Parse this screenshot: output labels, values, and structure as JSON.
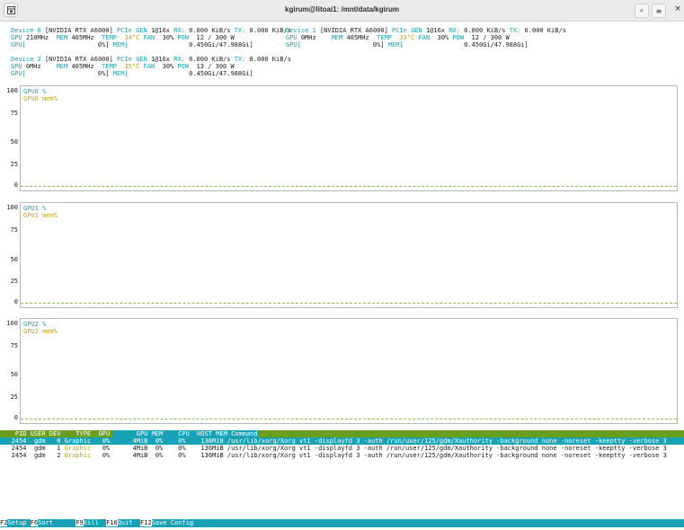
{
  "window": {
    "title": "kgirum@litoai1: /mnt/data/kgirum",
    "icons": {
      "new_tab": "terminal-newtab-icon",
      "search": "search-icon",
      "menu": "hamburger-menu-icon",
      "close": "close-icon"
    },
    "search_glyph": "⌕",
    "menu_glyph": "≡",
    "close_glyph": "×"
  },
  "devices": {
    "dev0": {
      "line1_a": "Device 0 ",
      "line1_b": "[NVIDIA RTX A6000] ",
      "line1_c": "PCIe GEN ",
      "line1_d": "1@16x ",
      "line1_e": "RX: ",
      "line1_f": "0.000 KiB/s ",
      "line1_g": "TX: ",
      "line1_h": "0.000 KiB/s ",
      "line2_a": "GPU ",
      "line2_b": "210MHz  ",
      "line2_c": "MEM ",
      "line2_d": "405MHz  ",
      "line2_e": "TEMP  ",
      "line2_f": "34°C ",
      "line2_g": "FAN  ",
      "line2_h": "30% ",
      "line2_i": "POW  ",
      "line2_j": "12 / 300 W",
      "line3_a": "GPU[",
      "line3_b": "                   0%] ",
      "line3_c": "MEM[",
      "line3_d": "                0.450Gi/47.988Gi]"
    },
    "dev1": {
      "line1_a": "Device 1 ",
      "line1_b": "[NVIDIA RTX A6000] ",
      "line1_c": "PCIe GEN ",
      "line1_d": "1@16x ",
      "line1_e": "RX: ",
      "line1_f": "0.000 KiB/s ",
      "line1_g": "TX: ",
      "line1_h": "0.000 KiB/s",
      "line2_a": "GPU ",
      "line2_b": "0MHz    ",
      "line2_c": "MEM ",
      "line2_d": "405MHz  ",
      "line2_e": "TEMP  ",
      "line2_f": "33°C ",
      "line2_g": "FAN  ",
      "line2_h": "30% ",
      "line2_i": "POW  ",
      "line2_j": "12 / 300 W",
      "line3_a": "GPU[",
      "line3_b": "                   0%] ",
      "line3_c": "MEM[",
      "line3_d": "                0.450Gi/47.988Gi]"
    },
    "dev2": {
      "line1_a": "Device 2 ",
      "line1_b": "[NVIDIA RTX A6000] ",
      "line1_c": "PCIe GEN ",
      "line1_d": "1@16x ",
      "line1_e": "RX: ",
      "line1_f": "0.000 KiB/s ",
      "line1_g": "TX: ",
      "line1_h": "0.000 KiB/s",
      "line2_a": "GPU ",
      "line2_b": "0MHz    ",
      "line2_c": "MEM ",
      "line2_d": "405MHz  ",
      "line2_e": "TEMP  ",
      "line2_f": "35°C ",
      "line2_g": "FAN  ",
      "line2_h": "30% ",
      "line2_i": "POW  ",
      "line2_j": "13 / 300 W",
      "line3_a": "GPU[",
      "line3_b": "                   0%] ",
      "line3_c": "MEM[",
      "line3_d": "                0.450Gi/47.988Gi]"
    }
  },
  "charts": {
    "ytick_labels": {
      "t100": "100",
      "t75": "75",
      "t50": "50",
      "t25": "25",
      "t0": "0"
    },
    "gpu0": {
      "util_label": "GPU0 %",
      "mem_label": "GPU0 mem%"
    },
    "gpu1": {
      "util_label": "GPU1 %",
      "mem_label": "GPU1 mem%"
    },
    "gpu2": {
      "util_label": "GPU2 %",
      "mem_label": "GPU2 mem%"
    }
  },
  "process_table": {
    "header_left": "    PID USER DEV    TYPE  GPU ",
    "header_right": "      GPU MEM    CPU  HOST MEM Command",
    "rows": [
      {
        "pid": "   2454",
        "user": "  gdm",
        "dev": "   0",
        "type": " Graphic",
        "gpu": "   0%",
        "gpu_mem": "      4MiB",
        "mem_pct": "  0%",
        "cpu": "    0%",
        "host_mem": "    136MiB",
        "command": " /usr/lib/xorg/Xorg vt1 -displayfd 3 -auth /run/user/125/gdm/Xauthority -background none -noreset -keeptty -verbose 3"
      },
      {
        "pid": "   2454",
        "user": "  gdm",
        "dev": "   1",
        "type": " Graphic",
        "gpu": "   0%",
        "gpu_mem": "      4MiB",
        "mem_pct": "  0%",
        "cpu": "    0%",
        "host_mem": "    136MiB",
        "command": " /usr/lib/xorg/Xorg vt1 -displayfd 3 -auth /run/user/125/gdm/Xauthority -background none -noreset -keeptty -verbose 3"
      },
      {
        "pid": "   2454",
        "user": "  gdm",
        "dev": "   2",
        "type": " Graphic",
        "gpu": "   0%",
        "gpu_mem": "      4MiB",
        "mem_pct": "  0%",
        "cpu": "    0%",
        "host_mem": "    136MiB",
        "command": " /usr/lib/xorg/Xorg vt1 -displayfd 3 -auth /run/user/125/gdm/Xauthority -background none -noreset -keeptty -verbose 3"
      }
    ]
  },
  "footer": {
    "f2_key": "F2",
    "f2_label": "Setup ",
    "f6_key": "F6",
    "f6_label": "Sort      ",
    "f9_key": "F9",
    "f9_label": "Kill  ",
    "f10_key": "F10",
    "f10_label": "Quit  ",
    "f12_key": "F12",
    "f12_label": "Save Config"
  },
  "colors": {
    "accent_cyan": "#17a2b8",
    "header_green": "#6a9e1f",
    "memline_yellow": "#c9a400",
    "zero_line_green": "#8bbf5a"
  }
}
